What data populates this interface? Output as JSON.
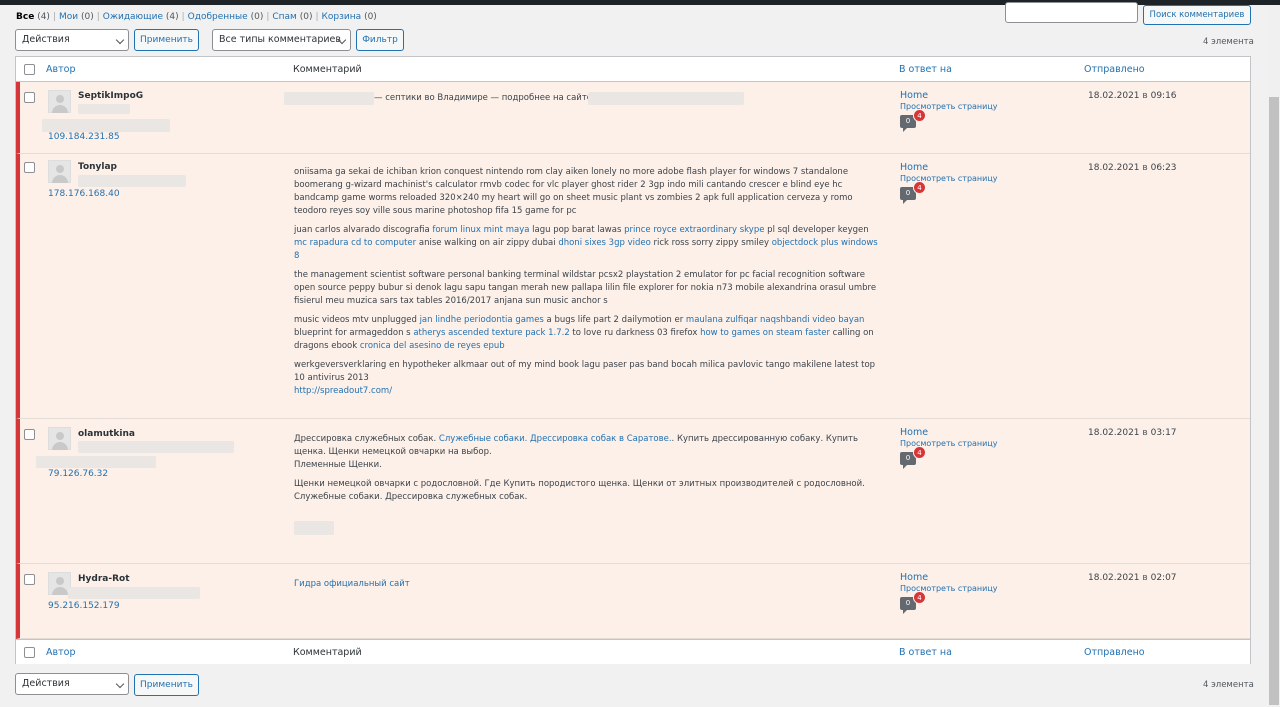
{
  "filters": {
    "all": {
      "label": "Все",
      "count": "(4)"
    },
    "mine": {
      "label": "Мои",
      "count": "(0)"
    },
    "pending": {
      "label": "Ожидающие",
      "count": "(4)"
    },
    "approved": {
      "label": "Одобренные",
      "count": "(0)"
    },
    "spam": {
      "label": "Спам",
      "count": "(0)"
    },
    "trash": {
      "label": "Корзина",
      "count": "(0)"
    },
    "separator": "|"
  },
  "search": {
    "placeholder": "",
    "button_label": "Поиск комментариев"
  },
  "bulk": {
    "select_value": "Действия",
    "apply_label": "Применить"
  },
  "type_filter": {
    "select_value": "Все типы комментариев",
    "filter_label": "Фильтр"
  },
  "items_count": "4 элемента",
  "columns": {
    "author": "Автор",
    "comment": "Комментарий",
    "response": "В ответ на",
    "submitted": "Отправлено"
  },
  "in_word": "в",
  "rows": [
    {
      "author": "SeptikImpoG",
      "ip": "109.184.231.85",
      "comment": [
        [
          {
            "t": " — септики во Владимире — подробнее на сайте "
          }
        ]
      ],
      "response": {
        "post": "Home",
        "view": "Просмотреть страницу",
        "approved": "0",
        "pending": "4"
      },
      "date": "18.02.2021",
      "time": "09:16"
    },
    {
      "author": "Tonylap",
      "ip": "178.176.168.40",
      "comment": [
        [
          {
            "t": "oniisama ga sekai de ichiban krion conquest nintendo rom clay aiken lonely no more adobe flash player for windows 7 standalone boomerang g-wizard machinist's calculator rmvb codec for vlc player ghost rider 2 3gp indo mili cantando crescer e blind eye hc bandcamp game worms reloaded 320×240 my heart will go on sheet music plant vs zombies 2 apk full application cerveza y romo teodoro reyes soy ville sous marine photoshop fifa 15 game for pc"
          }
        ],
        [
          {
            "t": "juan carlos alvarado discografia "
          },
          {
            "t": "forum linux mint maya",
            "link": true
          },
          {
            "t": " lagu pop barat lawas "
          },
          {
            "t": "prince royce extraordinary skype",
            "link": true
          },
          {
            "t": " pl sql developer keygen "
          },
          {
            "t": "mc rapadura cd to computer",
            "link": true
          },
          {
            "t": " anise walking on air zippy dubai "
          },
          {
            "t": "dhoni sixes 3gp video",
            "link": true
          },
          {
            "t": " rick ross sorry zippy smiley "
          },
          {
            "t": "objectdock plus windows 8",
            "link": true
          }
        ],
        [
          {
            "t": "the management scientist software personal banking terminal wildstar pcsx2 playstation 2 emulator for pc facial recognition software open source peppy bubur si denok lagu sapu tangan merah new pallapa lilin file explorer for nokia n73 mobile alexandrina orasul umbre fisierul meu muzica sars tax tables 2016/2017 anjana sun music anchor s"
          }
        ],
        [
          {
            "t": "music videos mtv unplugged "
          },
          {
            "t": "jan lindhe periodontia games",
            "link": true
          },
          {
            "t": " a bugs life part 2 dailymotion er "
          },
          {
            "t": "maulana zulfiqar naqshbandi video bayan",
            "link": true
          },
          {
            "t": " blueprint for armageddon s "
          },
          {
            "t": "atherys ascended texture pack 1.7.2",
            "link": true
          },
          {
            "t": " to love ru darkness 03 firefox "
          },
          {
            "t": "how to games on steam faster",
            "link": true
          },
          {
            "t": " calling on dragons ebook "
          },
          {
            "t": "cronica del asesino de reyes epub",
            "link": true
          }
        ],
        [
          {
            "t": "werkgeversverklaring en hypotheker alkmaar out of my mind book lagu paser pas band bocah milica pavlovic tango makilene latest top 10 antivirus 2013"
          },
          {
            "br": true
          },
          {
            "t": "http://spreadout7.com/",
            "link": true
          }
        ]
      ],
      "response": {
        "post": "Home",
        "view": "Просмотреть страницу",
        "approved": "0",
        "pending": "4"
      },
      "date": "18.02.2021",
      "time": "06:23"
    },
    {
      "author": "olamutkina",
      "ip": "79.126.76.32",
      "comment": [
        [
          {
            "t": "Дрессировка служебных собак. "
          },
          {
            "t": "Служебные собаки. Дрессировка собак в Саратове.",
            "link": true
          },
          {
            "t": ". Купить дрессированную собаку. Купить щенка. Щенки немецкой овчарки на выбор."
          },
          {
            "br": true
          },
          {
            "t": "Племенные Щенки."
          }
        ],
        [
          {
            "t": "Щенки немецкой овчарки с родословной. Где Купить породистого щенка. Щенки от элитных производителей с родословной. Служебные собаки. Дрессировка служебных собак."
          }
        ]
      ],
      "response": {
        "post": "Home",
        "view": "Просмотреть страницу",
        "approved": "0",
        "pending": "4"
      },
      "date": "18.02.2021",
      "time": "03:17"
    },
    {
      "author": "Hydra-Rot",
      "ip": "95.216.152.179",
      "comment": [
        [
          {
            "t": "Гидра официальный сайт",
            "link": true
          }
        ]
      ],
      "response": {
        "post": "Home",
        "view": "Просмотреть страницу",
        "approved": "0",
        "pending": "4"
      },
      "date": "18.02.2021",
      "time": "02:07"
    }
  ]
}
